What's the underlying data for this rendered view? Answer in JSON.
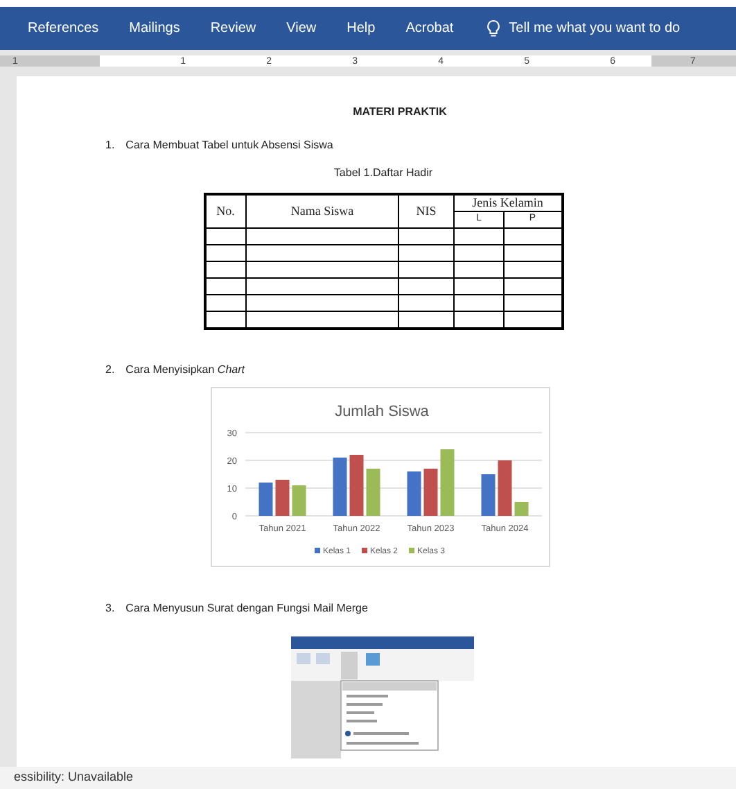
{
  "ribbon": {
    "tabs": [
      {
        "label": "References"
      },
      {
        "label": "Mailings"
      },
      {
        "label": "Review"
      },
      {
        "label": "View"
      },
      {
        "label": "Help"
      },
      {
        "label": "Acrobat"
      }
    ],
    "search": {
      "placeholder": "Tell me what you want to do"
    }
  },
  "ruler": {
    "left_number": "1",
    "numbers": [
      "1",
      "2",
      "3",
      "4",
      "5",
      "6"
    ],
    "right_number": "7"
  },
  "document": {
    "title": "MATERI PRAKTIK",
    "sections": [
      {
        "number": "1.",
        "heading": "Cara Membuat Tabel untuk Absensi Siswa",
        "kind": "table"
      },
      {
        "number": "2.",
        "heading": "Cara Menyisipkan *Chart*",
        "kind": "chart"
      },
      {
        "number": "3.",
        "heading": "Cara Menyusun Surat dengan Fungsi Mail Merge",
        "kind": "image"
      }
    ],
    "table": {
      "caption": "Tabel 1.Daftar Hadir",
      "columns": [
        "No.",
        "Nama Siswa",
        "NIS"
      ],
      "group_column": "Jenis Kelamin",
      "sub_columns": [
        "L",
        "P"
      ]
    },
    "chart": {
      "chart_data": {
        "type": "bar",
        "title": "Jumlah Siswa",
        "categories": [
          "Tahun 2021",
          "Tahun 2022",
          "Tahun 2023",
          "Tahun 2024"
        ],
        "ylim": [
          0,
          30
        ],
        "legend": "bottom",
        "yticks": [
          0,
          10,
          20,
          30
        ],
        "series": [
          {
            "name": "Kelas 1",
            "color": "#4472c4",
            "values": [
              12,
              21,
              16,
              15
            ]
          },
          {
            "name": "Kelas 2",
            "color": "#c0504d",
            "values": [
              13,
              22,
              17,
              20
            ]
          },
          {
            "name": "Kelas 3",
            "color": "#9bbb59",
            "values": [
              11,
              17,
              24,
              5
            ]
          }
        ]
      }
    }
  },
  "status_bar": {
    "text": "essibility: Unavailable"
  }
}
